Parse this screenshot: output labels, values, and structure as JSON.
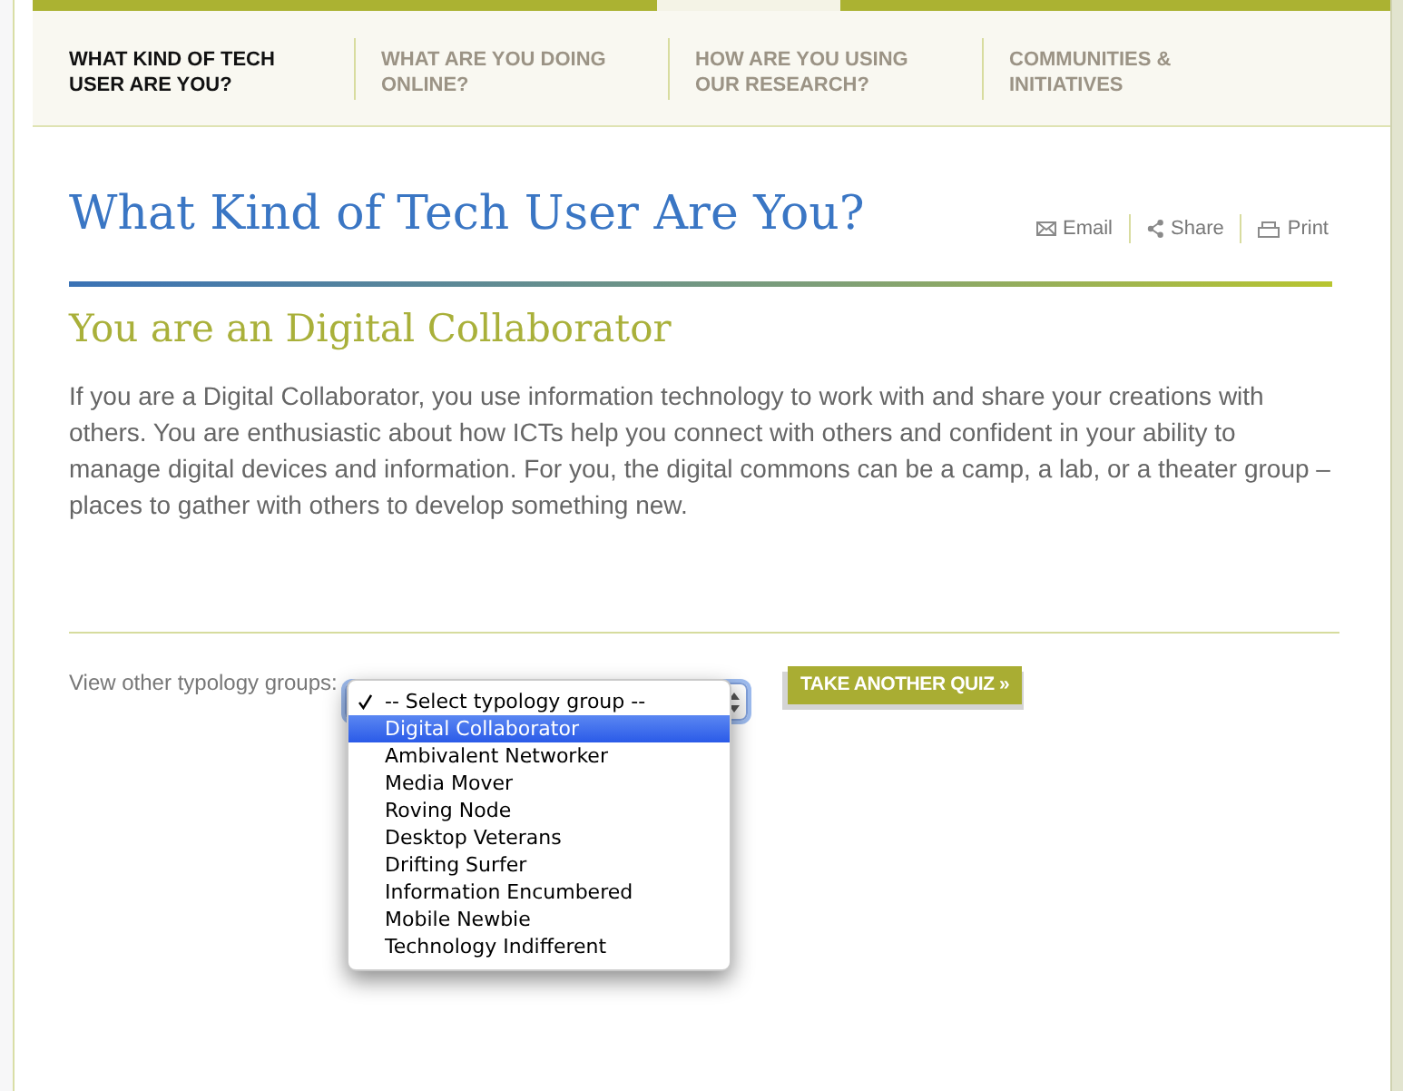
{
  "nav_tabs": [
    {
      "label": "WHAT KIND OF TECH USER ARE YOU?",
      "selected": true
    },
    {
      "label": "WHAT ARE YOU DOING ONLINE?",
      "selected": false
    },
    {
      "label": "HOW ARE YOU USING OUR RESEARCH?",
      "selected": false
    },
    {
      "label": "COMMUNITIES & INITIATIVES",
      "selected": false
    }
  ],
  "page": {
    "title": "What Kind of Tech User Are You?",
    "actions": [
      {
        "kind": "email",
        "label": "Email"
      },
      {
        "kind": "share",
        "label": "Share"
      },
      {
        "kind": "print",
        "label": "Print"
      }
    ]
  },
  "result": {
    "heading": "You are an Digital Collaborator",
    "description": "If you are a Digital Collaborator, you use information technology to work with and share your creations with others. You are enthusiastic about how ICTs help you connect with others and confident in your ability to manage digital devices and information. For you, the digital commons can be a camp, a lab, or a theater group – places to gather with others to develop something new."
  },
  "typology_picker": {
    "label": "View other typology groups:",
    "expanded": true,
    "options": [
      {
        "label": "-- Select typology group --",
        "selected": true,
        "highlighted": false
      },
      {
        "label": "Digital Collaborator",
        "selected": false,
        "highlighted": true
      },
      {
        "label": "Ambivalent Networker",
        "selected": false,
        "highlighted": false
      },
      {
        "label": "Media Mover",
        "selected": false,
        "highlighted": false
      },
      {
        "label": "Roving Node",
        "selected": false,
        "highlighted": false
      },
      {
        "label": "Desktop Veterans",
        "selected": false,
        "highlighted": false
      },
      {
        "label": "Drifting Surfer",
        "selected": false,
        "highlighted": false
      },
      {
        "label": "Information Encumbered",
        "selected": false,
        "highlighted": false
      },
      {
        "label": "Mobile Newbie",
        "selected": false,
        "highlighted": false
      },
      {
        "label": "Technology Indifferent",
        "selected": false,
        "highlighted": false
      }
    ]
  },
  "quiz_button": {
    "label": "TAKE ANOTHER QUIZ »"
  }
}
